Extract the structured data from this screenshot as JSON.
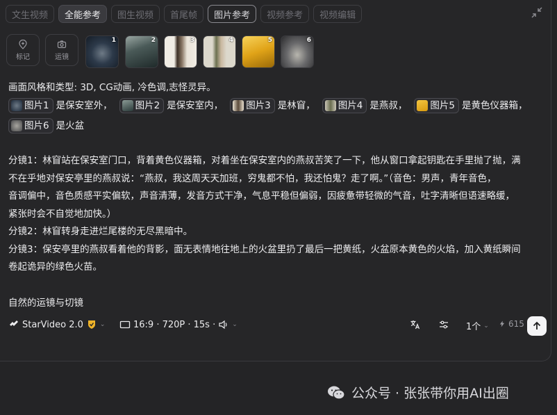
{
  "tabs": [
    {
      "label": "文生视频",
      "state": "inactive"
    },
    {
      "label": "全能参考",
      "state": "active"
    },
    {
      "label": "图生视频",
      "state": "inactive"
    },
    {
      "label": "首尾帧",
      "state": "inactive"
    },
    {
      "label": "图片参考",
      "state": "selected"
    },
    {
      "label": "视频参考",
      "state": "inactive"
    },
    {
      "label": "视频编辑",
      "state": "inactive"
    }
  ],
  "tools": {
    "mark_label": "标记",
    "camera_label": "运镜"
  },
  "references": [
    {
      "num": "1",
      "chip": "图片1",
      "desc": "是保安室外，",
      "colors": [
        "#1d2a3a",
        "#5f6b78"
      ]
    },
    {
      "num": "2",
      "chip": "图片2",
      "desc": "是保安室内，",
      "colors": [
        "#2b3b3a",
        "#8a9a95"
      ]
    },
    {
      "num": "3",
      "chip": "图片3",
      "desc": "是林窅，",
      "colors": [
        "#e8e0d0",
        "#5a4a3a"
      ]
    },
    {
      "num": "4",
      "chip": "图片4",
      "desc": "是燕叔，",
      "colors": [
        "#6b6e50",
        "#c9c4b5"
      ]
    },
    {
      "num": "5",
      "chip": "图片5",
      "desc": "是黄色仪器箱，",
      "colors": [
        "#d89a10",
        "#f3c540"
      ]
    },
    {
      "num": "6",
      "chip": "图片6",
      "desc": "是火盆",
      "colors": [
        "#4a4a4c",
        "#a8a6a0"
      ]
    }
  ],
  "prompt": {
    "style_line": "画面风格和类型: 3D, CG动画, 冷色调,志怪灵异。",
    "shot1_lines": [
      "分镜1：林窅站在保安室门口，背着黄色仪器箱，对着坐在保安室内的燕叔苦笑了一下，他从窗口拿起钥匙在手里抛了抛，满",
      "不在乎地对保安亭里的燕叔说：“燕叔，我这周天天加班，穷鬼都不怕，我还怕鬼？走了啊。”（音色：男声，青年音色，",
      "音调偏中，音色质感平实偏软，声音清薄，发音方式干净，气息平稳但偏弱，因疲惫带轻微的气音，吐字清晰但语速略缓，",
      "紧张时会不自觉地加快。）"
    ],
    "shot2_line": "分镜2：林窅转身走进烂尾楼的无尽黑暗中。",
    "shot3_lines": [
      "分镜3：保安亭里的燕叔看着他的背影，面无表情地往地上的火盆里扔了最后一把黄纸，火盆原本黄色的火焰，加入黄纸瞬间",
      "卷起诡异的绿色火苗。"
    ],
    "closing_line": "自然的运镜与切镜"
  },
  "toolbar": {
    "model_label": "StarVideo 2.0",
    "settings_label": "16:9 · 720P · 15s ·",
    "count_label": "1个",
    "credits": "615"
  },
  "watermark": {
    "text": "公众号 · 张张带你用AI出圈"
  },
  "colors": {
    "background": "#242426",
    "panel": "#262628",
    "accent_gold": "#f0b429",
    "text": "#ececee"
  }
}
